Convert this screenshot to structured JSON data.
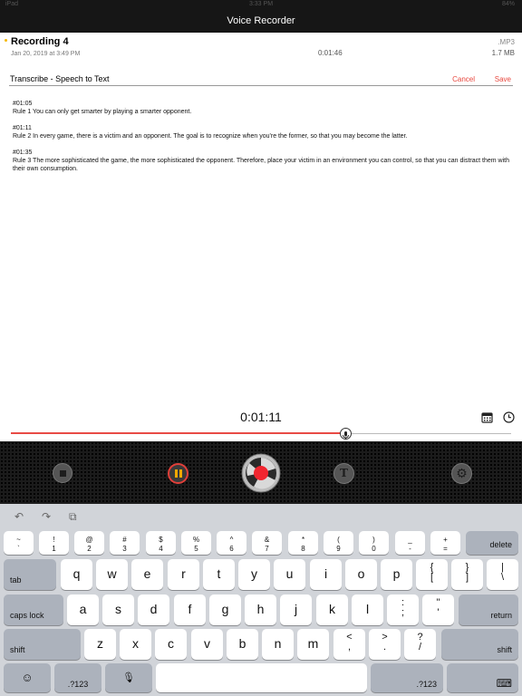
{
  "status_bar": {
    "left": "iPad",
    "time": "3:33 PM",
    "battery": "84%"
  },
  "app": {
    "title": "Voice Recorder"
  },
  "recording": {
    "name": "Recording 4",
    "date": "Jan 20, 2019 at 3:49 PM",
    "duration": "0:01:46",
    "format": ".MP3",
    "size": "1.7 MB"
  },
  "transcribe": {
    "title": "Transcribe - Speech to Text",
    "cancel": "Cancel",
    "save": "Save"
  },
  "transcript": [
    {
      "time": "#01:05",
      "text": "Rule 1 You can only get smarter by playing a smarter opponent."
    },
    {
      "time": "#01:11",
      "text": "Rule 2 In every game, there is a victim and an opponent. The goal is to recognize when you're the former, so that you may become the latter."
    },
    {
      "time": "#01:35",
      "text": "Rule 3 The more sophisticated the game, the more sophisticated the opponent. Therefore, place your victim in an environment you can control, so that you can distract them with their own consumption."
    }
  ],
  "player": {
    "current_time": "0:01:11",
    "progress": 0.668
  },
  "controls": {
    "text_glyph": "T",
    "gear_glyph": "⚙"
  },
  "colors": {
    "accent": "#e8483f",
    "record_red": "#f0252f",
    "pause_yellow": "#f0a800"
  },
  "keyboard": {
    "toolbar": {
      "undo": "↶",
      "redo": "↷",
      "paste": "⧉"
    },
    "number_row": [
      {
        "top": "~",
        "bottom": "`"
      },
      {
        "top": "!",
        "bottom": "1"
      },
      {
        "top": "@",
        "bottom": "2"
      },
      {
        "top": "#",
        "bottom": "3"
      },
      {
        "top": "$",
        "bottom": "4"
      },
      {
        "top": "%",
        "bottom": "5"
      },
      {
        "top": "^",
        "bottom": "6"
      },
      {
        "top": "&",
        "bottom": "7"
      },
      {
        "top": "*",
        "bottom": "8"
      },
      {
        "top": "(",
        "bottom": "9"
      },
      {
        "top": ")",
        "bottom": "0"
      },
      {
        "top": "_",
        "bottom": "-"
      },
      {
        "top": "+",
        "bottom": "="
      }
    ],
    "delete": "delete",
    "tab": "tab",
    "row_q": [
      "q",
      "w",
      "e",
      "r",
      "t",
      "y",
      "u",
      "i",
      "o",
      "p"
    ],
    "row_q_syms": [
      {
        "top": "{",
        "bottom": "["
      },
      {
        "top": "}",
        "bottom": "]"
      },
      {
        "top": "|",
        "bottom": "\\"
      }
    ],
    "caps": "caps lock",
    "row_a": [
      "a",
      "s",
      "d",
      "f",
      "g",
      "h",
      "j",
      "k",
      "l"
    ],
    "row_a_syms": [
      {
        "top": ":",
        "bottom": ";"
      },
      {
        "top": "\"",
        "bottom": "'"
      }
    ],
    "return": "return",
    "shift": "shift",
    "row_z": [
      "z",
      "x",
      "c",
      "v",
      "b",
      "n",
      "m"
    ],
    "row_z_syms": [
      {
        "top": "<",
        "bottom": ","
      },
      {
        "top": ">",
        "bottom": "."
      },
      {
        "top": "?",
        "bottom": "/"
      }
    ],
    "emoji": "☺",
    "num_toggle": ".?123",
    "mic": "🎙",
    "hide": "⌨"
  }
}
